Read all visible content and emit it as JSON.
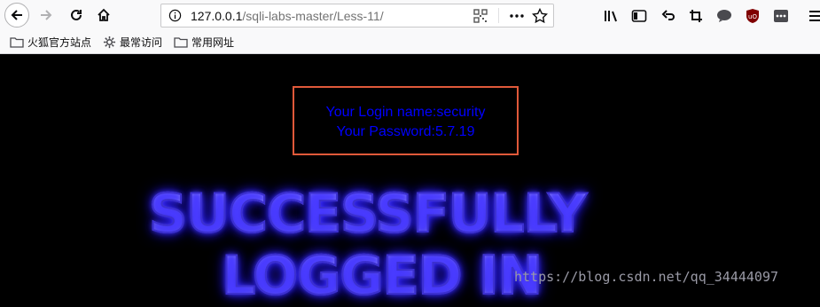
{
  "browser": {
    "url_host": "127.0.0.1",
    "url_path": "/sqli-labs-master/Less-11/",
    "bookmarks": [
      {
        "label": "火狐官方站点",
        "icon": "folder-icon"
      },
      {
        "label": "最常访问",
        "icon": "gear-icon"
      },
      {
        "label": "常用网址",
        "icon": "folder-icon"
      }
    ],
    "toolbar_icons": [
      "library-icon",
      "sidebar-icon",
      "undo-icon",
      "crop-icon",
      "chat-icon",
      "ublock-icon",
      "extension-icon",
      "menu-icon"
    ],
    "accent_color": "#e0593a"
  },
  "page": {
    "login_name": "Your Login name:security",
    "password": "Your Password:5.7.19",
    "banner_line1": "SUCCESSFULLY",
    "banner_line2": "LOGGED IN",
    "text_color": "#0000ff",
    "background_color": "#000000"
  },
  "watermark": "https://blog.csdn.net/qq_34444097"
}
